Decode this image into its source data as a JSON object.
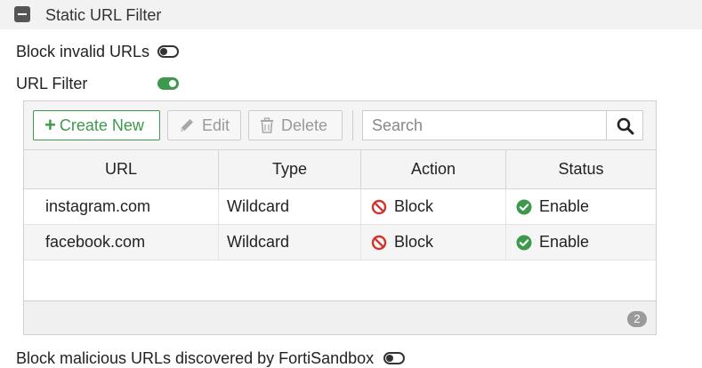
{
  "section": {
    "title": "Static URL Filter"
  },
  "options": {
    "block_invalid_urls": {
      "label": "Block invalid URLs",
      "enabled": false
    },
    "url_filter": {
      "label": "URL Filter",
      "enabled": true
    },
    "block_malicious": {
      "label": "Block malicious URLs discovered by FortiSandbox",
      "enabled": false
    }
  },
  "toolbar": {
    "create_label": "Create New",
    "edit_label": "Edit",
    "delete_label": "Delete",
    "search_placeholder": "Search"
  },
  "table": {
    "columns": [
      "URL",
      "Type",
      "Action",
      "Status"
    ],
    "rows": [
      {
        "url": "instagram.com",
        "type": "Wildcard",
        "action": "Block",
        "status": "Enable"
      },
      {
        "url": "facebook.com",
        "type": "Wildcard",
        "action": "Block",
        "status": "Enable"
      }
    ],
    "count": "2"
  },
  "icons": {
    "collapse": "minus-square-icon",
    "create": "plus-icon",
    "edit": "pencil-icon",
    "delete": "trash-icon",
    "search": "search-icon",
    "block": "prohibited-icon",
    "enable": "check-circle-icon"
  },
  "colors": {
    "accent_green": "#3d9a4c",
    "block_red": "#d0342c",
    "enable_green": "#3d9a4c",
    "disabled_text": "#999999"
  }
}
